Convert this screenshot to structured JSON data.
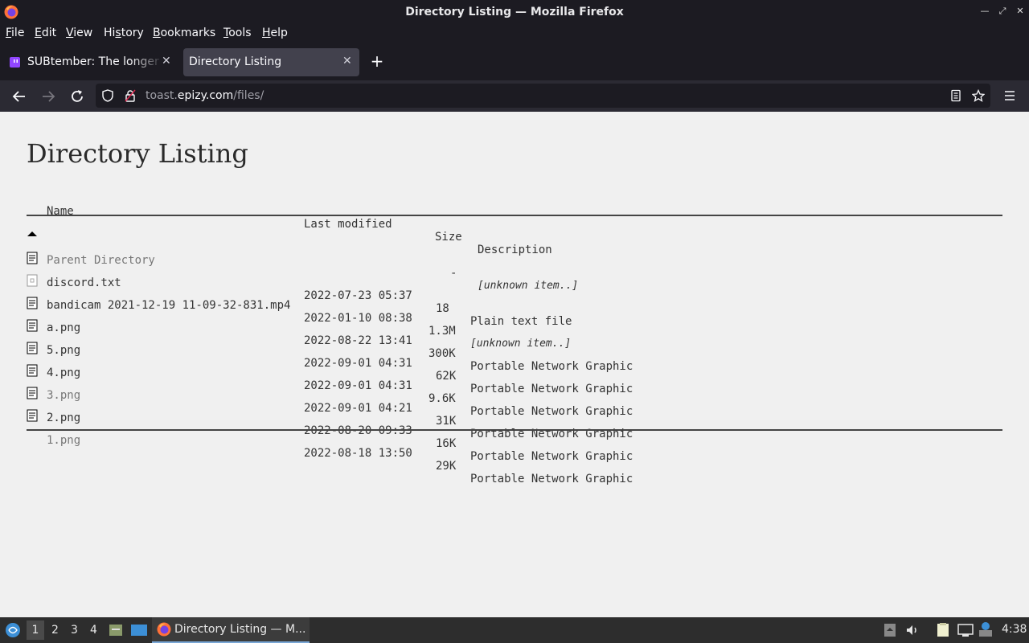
{
  "window": {
    "title": "Directory Listing — Mozilla Firefox"
  },
  "menu": {
    "items": [
      {
        "pre": "",
        "key": "F",
        "post": "ile"
      },
      {
        "pre": "",
        "key": "E",
        "post": "dit"
      },
      {
        "pre": "",
        "key": "V",
        "post": "iew"
      },
      {
        "pre": "Hi",
        "key": "s",
        "post": "tory"
      },
      {
        "pre": "",
        "key": "B",
        "post": "ookmarks"
      },
      {
        "pre": "",
        "key": "T",
        "post": "ools"
      },
      {
        "pre": "",
        "key": "H",
        "post": "elp"
      }
    ]
  },
  "tabs": [
    {
      "label": "SUBtember: The longer the stream",
      "favicon": "twitch-icon"
    },
    {
      "label": "Directory Listing",
      "favicon": ""
    }
  ],
  "url": {
    "domain": "toast.epizy.com",
    "prefix": "toast.",
    "host": "epizy.com",
    "path": "/files/"
  },
  "page": {
    "title": "Directory Listing",
    "headers": {
      "name": "Name",
      "modified": "Last modified",
      "size": "Size",
      "description": "Description"
    },
    "rows": [
      {
        "icon": "back-icon",
        "name": "Parent Directory",
        "modified": "",
        "size": "-",
        "description": "[unknown item..]",
        "dim": true
      },
      {
        "icon": "text-file-icon",
        "name": "discord.txt",
        "modified": "2022-07-23 05:37",
        "size": "18",
        "description": "Plain text file",
        "dim": false
      },
      {
        "icon": "generic-file-icon",
        "name": "bandicam 2021-12-19 11-09-32-831.mp4",
        "modified": "2022-01-10 08:38",
        "size": "1.3M",
        "description": "[unknown item..]",
        "dim": false
      },
      {
        "icon": "text-file-icon",
        "name": "a.png",
        "modified": "2022-08-22 13:41",
        "size": "300K",
        "description": "Portable Network Graphic",
        "dim": false
      },
      {
        "icon": "text-file-icon",
        "name": "5.png",
        "modified": "2022-09-01 04:31",
        "size": "62K",
        "description": "Portable Network Graphic",
        "dim": false
      },
      {
        "icon": "text-file-icon",
        "name": "4.png",
        "modified": "2022-09-01 04:31",
        "size": "9.6K",
        "description": "Portable Network Graphic",
        "dim": false
      },
      {
        "icon": "text-file-icon",
        "name": "3.png",
        "modified": "2022-09-01 04:21",
        "size": "31K",
        "description": "Portable Network Graphic",
        "dim": true
      },
      {
        "icon": "text-file-icon",
        "name": "2.png",
        "modified": "2022-08-20 09:33",
        "size": "16K",
        "description": "Portable Network Graphic",
        "dim": false
      },
      {
        "icon": "text-file-icon",
        "name": "1.png",
        "modified": "2022-08-18 13:50",
        "size": "29K",
        "description": "Portable Network Graphic",
        "dim": true
      }
    ]
  },
  "taskbar": {
    "workspaces": [
      "1",
      "2",
      "3",
      "4"
    ],
    "active_task": "Directory Listing — M...",
    "clock": "4:38"
  }
}
